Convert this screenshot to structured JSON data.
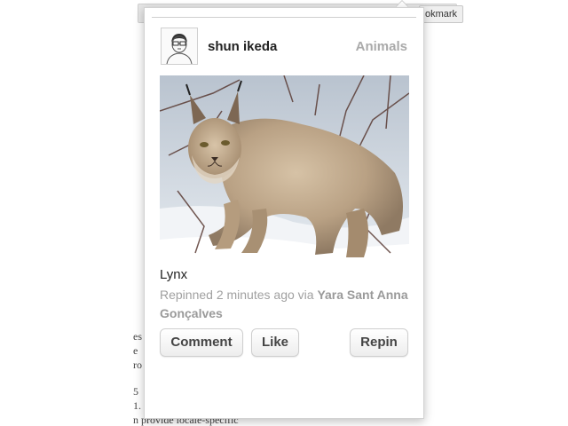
{
  "browser": {
    "bookmark_tab": "okmark",
    "bg_lines": [
      "es",
      "e",
      "ro",
      "5",
      "1.",
      "n provide locale-specific"
    ]
  },
  "pin": {
    "user": {
      "name": "shun ikeda",
      "avatar_icon": "user-avatar-icon"
    },
    "board": "Animals",
    "caption": "Lynx",
    "repin": {
      "prefix": "Repinned 2 minutes ago via ",
      "source": "Yara Sant Anna Gonçalves"
    }
  },
  "actions": {
    "comment_label": "Comment",
    "like_label": "Like",
    "repin_label": "Repin"
  },
  "colors": {
    "text_dark": "#222222",
    "text_muted": "#a0a0a0",
    "button_border": "#cfcfcf"
  }
}
